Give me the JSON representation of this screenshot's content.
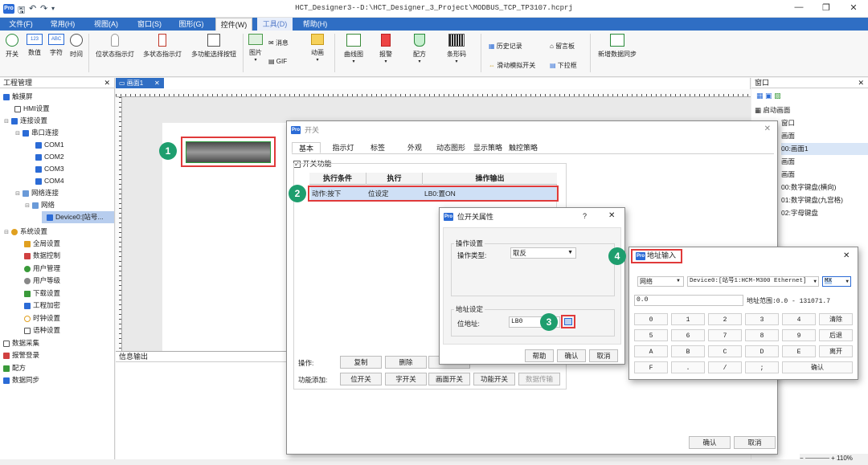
{
  "titlebar": {
    "title": "HCT_Designer3--D:\\HCT_Designer_3_Project\\MODBUS_TCP_TP3107.hcprj",
    "logo": "Pro",
    "minimize": "—",
    "maximize": "❐",
    "close": "✕"
  },
  "menus": [
    "文件(F)",
    "常用(H)",
    "视图(A)",
    "窗口(S)",
    "图形(G)",
    "控件(W)",
    "工具(D)",
    "帮助(H)"
  ],
  "ribbon": {
    "g1": [
      "开关",
      "数值",
      "字符",
      "时间"
    ],
    "g2": [
      "位状态指示灯",
      "多状态指示灯",
      "多功能选择按钮"
    ],
    "picture": "图片",
    "message": "消息",
    "gif": "GIF",
    "anim": "动画",
    "g3": [
      "曲线图",
      "报警",
      "配方",
      "条形码"
    ],
    "history": "历史记录",
    "note": "留言板",
    "slide": "滑动模拟开关",
    "dropdown": "下拉框",
    "sync": "新增数据同步"
  },
  "left_panel": {
    "title": "工程管理",
    "close": "✕",
    "tree": [
      "触摸屏",
      "HMI设置",
      "连接设置",
      "串口连接",
      "COM1",
      "COM2",
      "COM3",
      "COM4",
      "网络连接",
      "网络",
      "Device0:[站号...",
      "系统设置",
      "全局设置",
      "数据控制",
      "用户管理",
      "用户等级",
      "下载设置",
      "工程加密",
      "时钟设置",
      "语种设置",
      "数据采集",
      "报警登录",
      "配方",
      "数据同步"
    ]
  },
  "doc": {
    "tab": "画面1",
    "close": "✕",
    "info_output": "信息输出"
  },
  "right_panel": {
    "title": "窗口",
    "close": "✕",
    "items": [
      "启动画面",
      "窗口",
      "画面",
      "00:画面1",
      "画面",
      "画面",
      "00:数字键盘(横向)",
      "01:数字键盘(九宫格)",
      "02:字母键盘"
    ]
  },
  "switch_dialog": {
    "title": "开关",
    "close": "✕",
    "tabs": [
      "基本",
      "指示灯",
      "标签",
      "外观",
      "动态图形",
      "显示策略",
      "触控策略"
    ],
    "checkbox": "开关功能",
    "columns": [
      "执行条件",
      "执行",
      "操作输出"
    ],
    "row": [
      "动作:按下",
      "位设定",
      "LB0:置ON"
    ],
    "op_label": "操作:",
    "buttons": [
      "复制",
      "删除"
    ],
    "func_label": "功能添加:",
    "func_buttons": [
      "位开关",
      "字开关",
      "画面开关",
      "功能开关",
      "数据传输"
    ],
    "ok": "确认",
    "cancel": "取消"
  },
  "bit_dialog": {
    "title": "位开关属性",
    "help": "?",
    "close": "✕",
    "op_group": "操作设置",
    "op_type_label": "操作类型:",
    "op_type": "取反",
    "addr_group": "地址设定",
    "addr_label": "位地址:",
    "addr": "LB0",
    "help_btn": "帮助",
    "ok": "确认",
    "cancel": "取消"
  },
  "addr_dialog": {
    "title": "地址输入",
    "close": "✕",
    "net": "网络",
    "device": "Device0:[站号1:HCM-M300 Ethernet]",
    "mx": "MX",
    "value": "0.0",
    "range": "地址范围:0.0 - 131071.7",
    "keys": [
      [
        "0",
        "1",
        "2",
        "3",
        "4",
        "清除"
      ],
      [
        "5",
        "6",
        "7",
        "8",
        "9",
        "后退"
      ],
      [
        "A",
        "B",
        "C",
        "D",
        "E",
        "离开"
      ]
    ],
    "last": [
      "F",
      ".",
      "/",
      ";",
      "确认"
    ]
  },
  "callouts": [
    "1",
    "2",
    "3",
    "4"
  ],
  "zoom": "110%",
  "colors": {
    "accent": "#2f6ec4",
    "callout": "#1e9e6e",
    "highlight": "#e03a3a",
    "selection": "#b7cdee"
  }
}
